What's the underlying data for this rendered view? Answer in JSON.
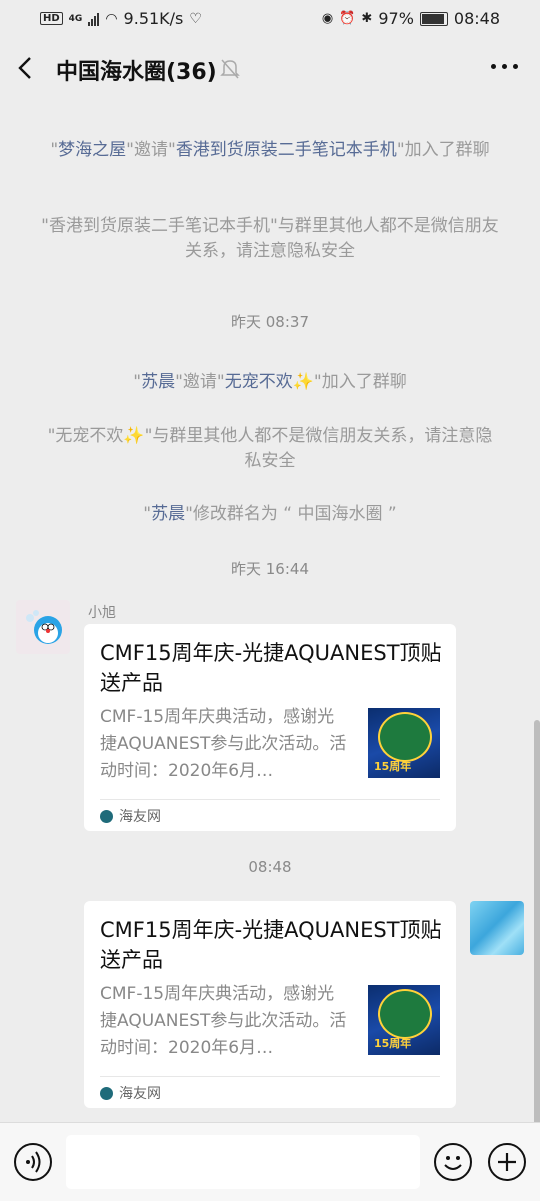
{
  "status": {
    "net_label": "HD",
    "net_type": "4G",
    "speed": "9.51K/s",
    "battery": "97%",
    "time": "08:48"
  },
  "header": {
    "title": "中国海水圈(36)"
  },
  "system_messages": [
    {
      "parts": [
        {
          "t": "\"",
          "hl": false
        },
        {
          "t": "梦海之屋",
          "hl": true
        },
        {
          "t": "\"邀请\"",
          "hl": false
        },
        {
          "t": "香港到货原装二手笔记本手机",
          "hl": true
        },
        {
          "t": "\"加入了群聊",
          "hl": false
        }
      ]
    },
    {
      "text": "\"香港到货原装二手笔记本手机\"与群里其他人都不是微信朋友关系，请注意隐私安全"
    },
    {
      "parts": [
        {
          "t": "\"",
          "hl": false
        },
        {
          "t": "苏晨",
          "hl": true
        },
        {
          "t": "\"邀请\"",
          "hl": false
        },
        {
          "t": "无宠不欢✨",
          "hl": true
        },
        {
          "t": "\"加入了群聊",
          "hl": false
        }
      ]
    },
    {
      "text": "\"无宠不欢✨\"与群里其他人都不是微信朋友关系，请注意隐私安全"
    },
    {
      "parts": [
        {
          "t": "\"",
          "hl": false
        },
        {
          "t": "苏晨",
          "hl": true
        },
        {
          "t": "\"修改群名为 “ 中国海水圈 ”",
          "hl": false
        }
      ]
    }
  ],
  "timestamps": [
    "昨天 08:37",
    "昨天 16:44",
    "08:48"
  ],
  "messages": [
    {
      "sender": "小旭",
      "title": "CMF15周年庆-光捷AQUANEST顶贴送产品",
      "desc": "CMF-15周年庆典活动，感谢光捷AQUANEST参与此次活动。活动时间：2020年6月…",
      "thumb_badge": "15周年",
      "source": "海友网"
    },
    {
      "sender": "",
      "title": "CMF15周年庆-光捷AQUANEST顶贴送产品",
      "desc": "CMF-15周年庆典活动，感谢光捷AQUANEST参与此次活动。活动时间：2020年6月…",
      "thumb_badge": "15周年",
      "source": "海友网"
    }
  ],
  "icons": {
    "voice": "voice-icon",
    "emoji": "emoji-icon",
    "plus": "plus-icon"
  },
  "colors": {
    "background": "#ededed",
    "name_highlight": "#576b95",
    "system_text": "#9a9a9a"
  }
}
